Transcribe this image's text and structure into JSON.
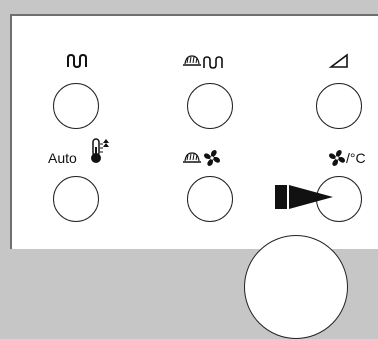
{
  "labels": {
    "auto": "Auto",
    "temp_unit": "/°C"
  },
  "icons": [
    "heater-icon",
    "defrost-heater-icon",
    "slope-icon",
    "thermostat-icon",
    "defrost-fan-icon",
    "fan-icon",
    "arrow-pointer-icon"
  ],
  "colors": {
    "background": "#c6c6c6",
    "panel": "#ffffff",
    "ink": "#111111"
  }
}
